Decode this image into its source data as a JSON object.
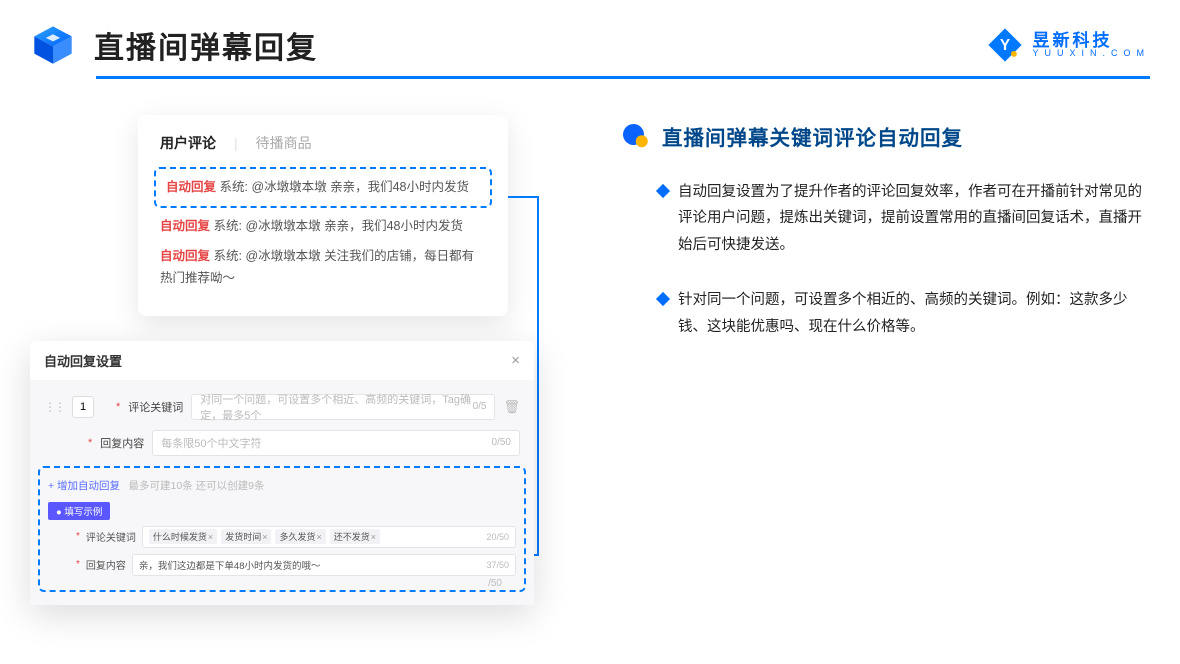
{
  "header": {
    "title": "直播间弹幕回复",
    "brand_cn": "昱新科技",
    "brand_en": "YUUXIN.COM"
  },
  "comments": {
    "tab_active": "用户评论",
    "tab_inactive": "待播商品",
    "items": [
      {
        "tag": "自动回复",
        "body": "系统: @冰墩墩本墩 亲亲，我们48小时内发货"
      },
      {
        "tag": "自动回复",
        "body": "系统: @冰墩墩本墩 亲亲，我们48小时内发货"
      },
      {
        "tag": "自动回复",
        "body": "系统: @冰墩墩本墩 关注我们的店铺，每日都有热门推荐呦～"
      }
    ]
  },
  "settings": {
    "dialog_title": "自动回复设置",
    "num": "1",
    "kw_label": "评论关键词",
    "kw_placeholder": "对同一个问题，可设置多个相近、高频的关键词，Tag确定，最多5个",
    "kw_count": "0/5",
    "content_label": "回复内容",
    "content_placeholder": "每条限50个中文字符",
    "content_count": "0/50",
    "add_link": "+ 增加自动回复",
    "add_hint": "最多可建10条 还可以创建9条",
    "example_badge": "● 填写示例",
    "ex_kw_label": "评论关键词",
    "ex_chips": [
      "什么时候发货",
      "发货时间",
      "多久发货",
      "还不发货"
    ],
    "ex_kw_count": "20/50",
    "ex_content_label": "回复内容",
    "ex_content_text": "亲，我们这边都是下单48小时内发货的哦～",
    "ex_content_count": "37/50",
    "foot_cap": "/50"
  },
  "right": {
    "section_title": "直播间弹幕关键词评论自动回复",
    "bullets": [
      "自动回复设置为了提升作者的评论回复效率，作者可在开播前针对常见的评论用户问题，提炼出关键词，提前设置常用的直播间回复话术，直播开始后可快捷发送。",
      "针对同一个问题，可设置多个相近的、高频的关键词。例如：这款多少钱、这块能优惠吗、现在什么价格等。"
    ]
  }
}
